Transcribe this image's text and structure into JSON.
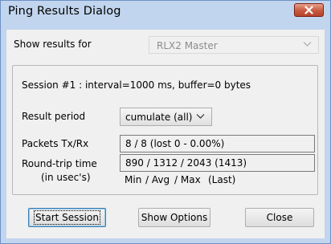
{
  "window": {
    "title": "Ping Results Dialog"
  },
  "icons": {
    "close": "close-icon",
    "dropdown": "chevron-down-icon"
  },
  "colors": {
    "titlebar": "#c2d5ee",
    "close_button": "#c75a3e",
    "default_button_border": "#3c7fb1"
  },
  "show_results": {
    "label": "Show results for",
    "selected": "RLX2 Master",
    "enabled": false
  },
  "session": {
    "info": "Session #1 : interval=1000 ms, buffer=0 bytes"
  },
  "result_period": {
    "label": "Result period",
    "selected": "cumulate (all)"
  },
  "packets": {
    "label": "Packets Tx/Rx",
    "value": "8 / 8  (lost 0 - 0.00%)"
  },
  "round_trip": {
    "label": "Round-trip time",
    "sublabel": "(in usec's)",
    "value": "890 / 1312 / 2043 (1413)",
    "legend": {
      "min": "Min",
      "avg": "/ Avg",
      "max": "/ Max",
      "last": "(Last)"
    }
  },
  "buttons": {
    "start_session": "Start Session",
    "show_options": "Show Options",
    "close": "Close"
  }
}
